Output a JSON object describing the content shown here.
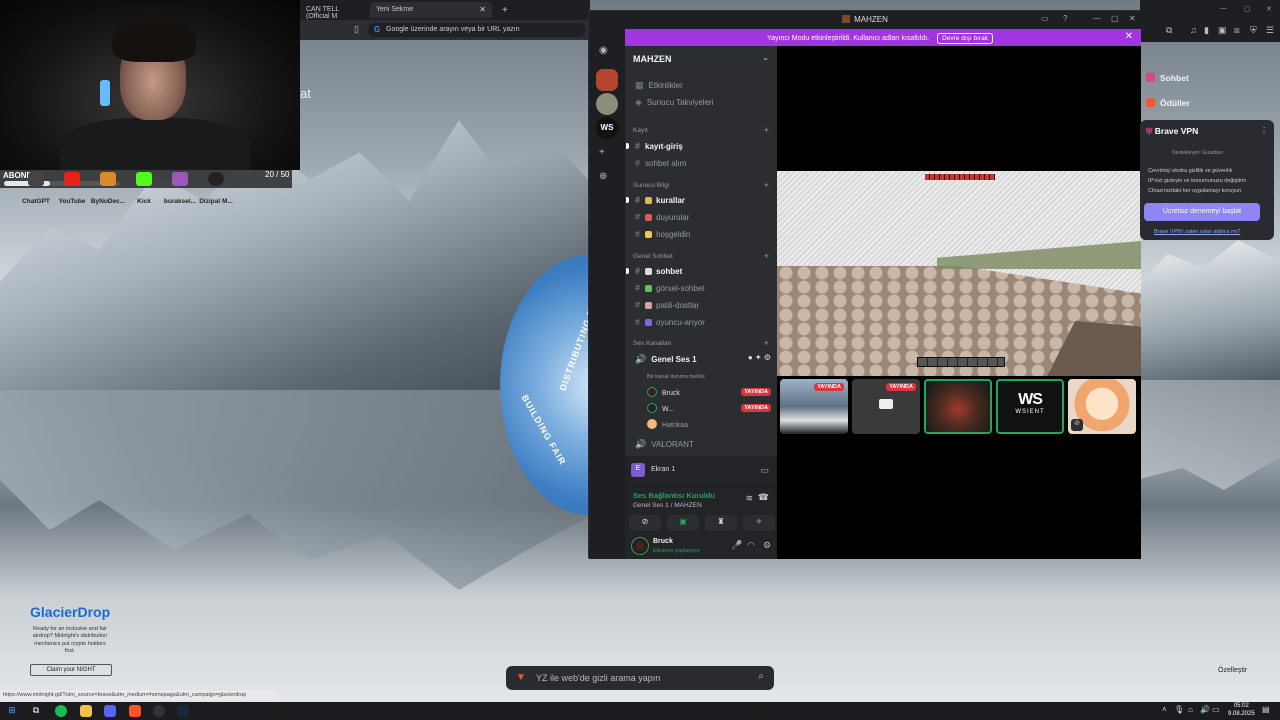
{
  "browser": {
    "tab1": "CAN TELL (Official M",
    "tab2": "Yeni Sekme",
    "address_placeholder": "Google üzerinde arayın veya bir URL yazın",
    "heading_fragment": "at",
    "status_url": "https://www.midnight.gd/?utm_source=brave&utm_medium=homepage&utm_campaign=glacierdrop"
  },
  "overlay": {
    "abone_label": "ABONE",
    "counter": "20 / 50",
    "progress": 0.4
  },
  "shortcuts": [
    "ChatGPT",
    "YouTube",
    "ByNoDec...",
    "Kick",
    "buraksel...",
    "Dizipal M..."
  ],
  "glacier": {
    "title": "GlacierDrop",
    "desc": "Ready for an inclusive and fair airdrop? Midnight's distribution mechanics put crypto holders first.",
    "button": "Claim your NIGHT"
  },
  "stamp_texts": [
    "DISTRIBUTING THE FAIR",
    "BUILDING FAIR"
  ],
  "newtab": {
    "search_placeholder": "YZ ile web'de gizli arama yapın",
    "customize": "Özelleştir"
  },
  "discord": {
    "window_title": "MAHZEN",
    "banner": "Yayıncı Modu etkinleştirildi. Kullanıcı adları kısaltıldı.",
    "banner_button": "Devre dışı bırak",
    "server_name": "MAHZEN",
    "top_items": [
      "Etkinlikler",
      "Sunucu Takviyeleri"
    ],
    "categories": [
      "Kayıt",
      "Sunucu Bilgi",
      "Genel Sohbet",
      "Ses Kanalları"
    ],
    "channels": {
      "kayit_giris": "kayıt-giriş",
      "sohbet_alim": "sohbet alım",
      "kurallar": "kurallar",
      "duyurular": "duyurular",
      "hosgeldin": "hoşgeldin",
      "sohbet": "sohbet",
      "gorsel": "görsel-sohbet",
      "patili": "patili-dostlar",
      "oyuncu": "oyuncu-arıyor",
      "genel_ses": "Genel Ses 1",
      "valorant": "VALORANT"
    },
    "vc_subtitle": "Bir kanal durumu belirle",
    "vc_users": [
      "Bruck",
      "W...",
      "Hatrikaa"
    ],
    "live_label": "YAYINDA",
    "stream_initial": "E",
    "stream_name": "Ekran 1",
    "voice_status": "Ses Bağlantısı Kuruldu",
    "voice_where": "Genel Ses 1 / MAHZEN",
    "user_name": "Bruck",
    "user_sub": "Ekranını paylaşıyor",
    "thumb_logo": "WS",
    "thumb_label": "WSIENT"
  },
  "brave": {
    "sohbet": "Sohbet",
    "oduller": "Ödüller",
    "vpn_title": "Brave VPN",
    "vpn_by": "Destekleyen: Guardian",
    "vpn_features": [
      "Çevrimiçi ekstra gizlilik ve güvenlik",
      "IP'nizi gizleyin ve konumunuzu değiştirin",
      "Cihazınızdaki her uygulamayı koruyun"
    ],
    "vpn_cta": "Ücretsiz denemeyi başlat",
    "vpn_link": "Brave VPN'i zaten satın aldınız mı?"
  },
  "taskbar": {
    "time": "05:02",
    "date": "9.08.2025"
  }
}
